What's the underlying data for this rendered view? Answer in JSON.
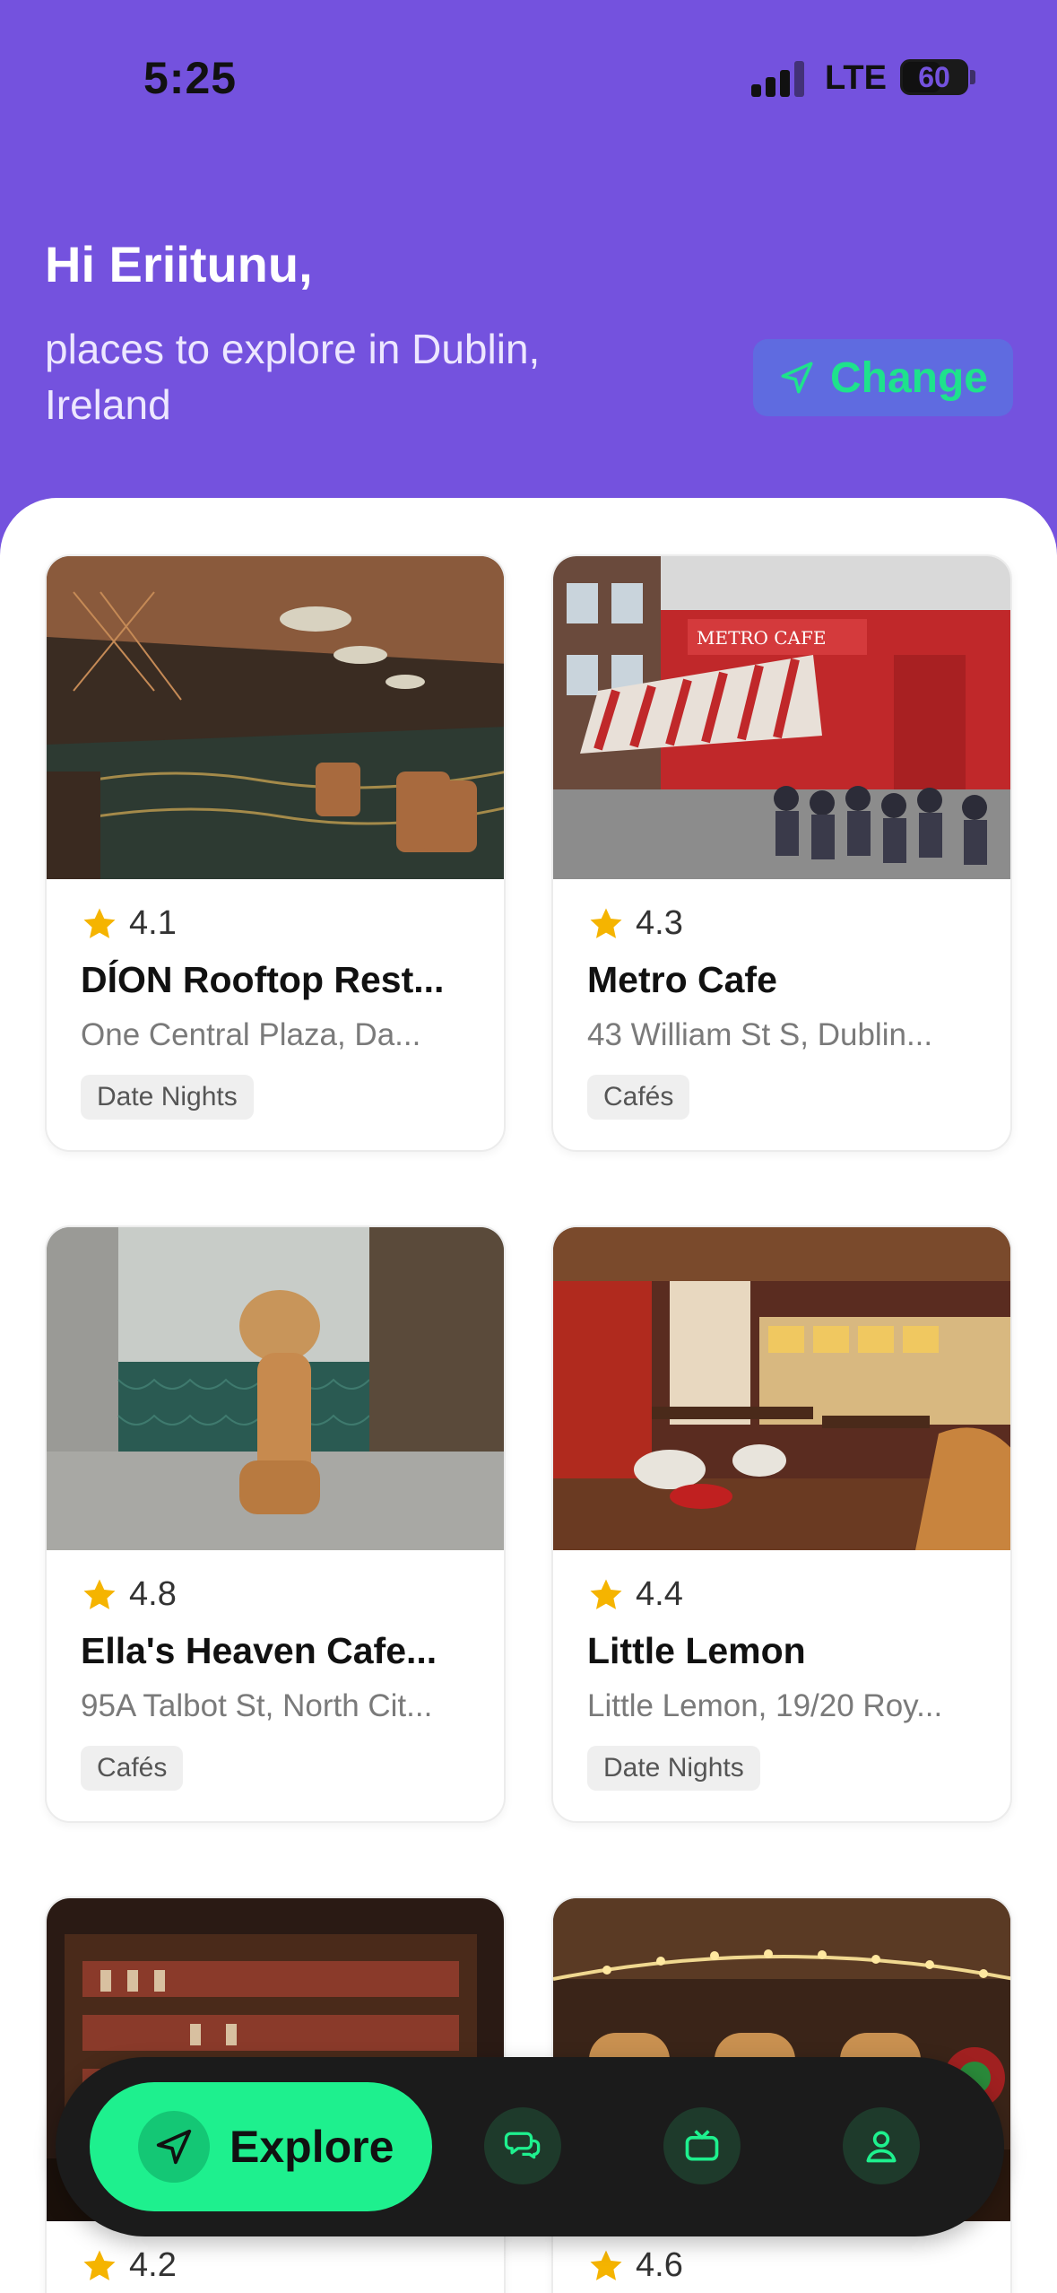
{
  "status_bar": {
    "time": "5:25",
    "network": "LTE",
    "battery": "60"
  },
  "header": {
    "greeting": "Hi Eriitunu,",
    "subtitle": "places to explore in Dublin, Ireland",
    "change_label": "Change"
  },
  "places": [
    {
      "rating": "4.1",
      "name": "DÍON Rooftop Rest...",
      "address": "One Central Plaza, Da...",
      "tag": "Date Nights"
    },
    {
      "rating": "4.3",
      "name": "Metro Cafe",
      "address": "43 William St S, Dublin...",
      "tag": "Cafés"
    },
    {
      "rating": "4.8",
      "name": "Ella's Heaven Cafe...",
      "address": "95A Talbot St, North Cit...",
      "tag": "Cafés"
    },
    {
      "rating": "4.4",
      "name": "Little Lemon",
      "address": "Little Lemon, 19/20 Roy...",
      "tag": "Date Nights"
    },
    {
      "rating": "4.2",
      "name": "",
      "address": "",
      "tag": ""
    },
    {
      "rating": "4.6",
      "name": "",
      "address": "",
      "tag": ""
    }
  ],
  "nav": {
    "explore_label": "Explore",
    "icons": [
      "navigation-icon",
      "chat-icon",
      "tv-icon",
      "profile-icon"
    ]
  },
  "colors": {
    "header_bg": "#7452DE",
    "accent_green": "#1EF08E",
    "star": "#F5B400",
    "nav_bg": "#1B1B1B"
  }
}
